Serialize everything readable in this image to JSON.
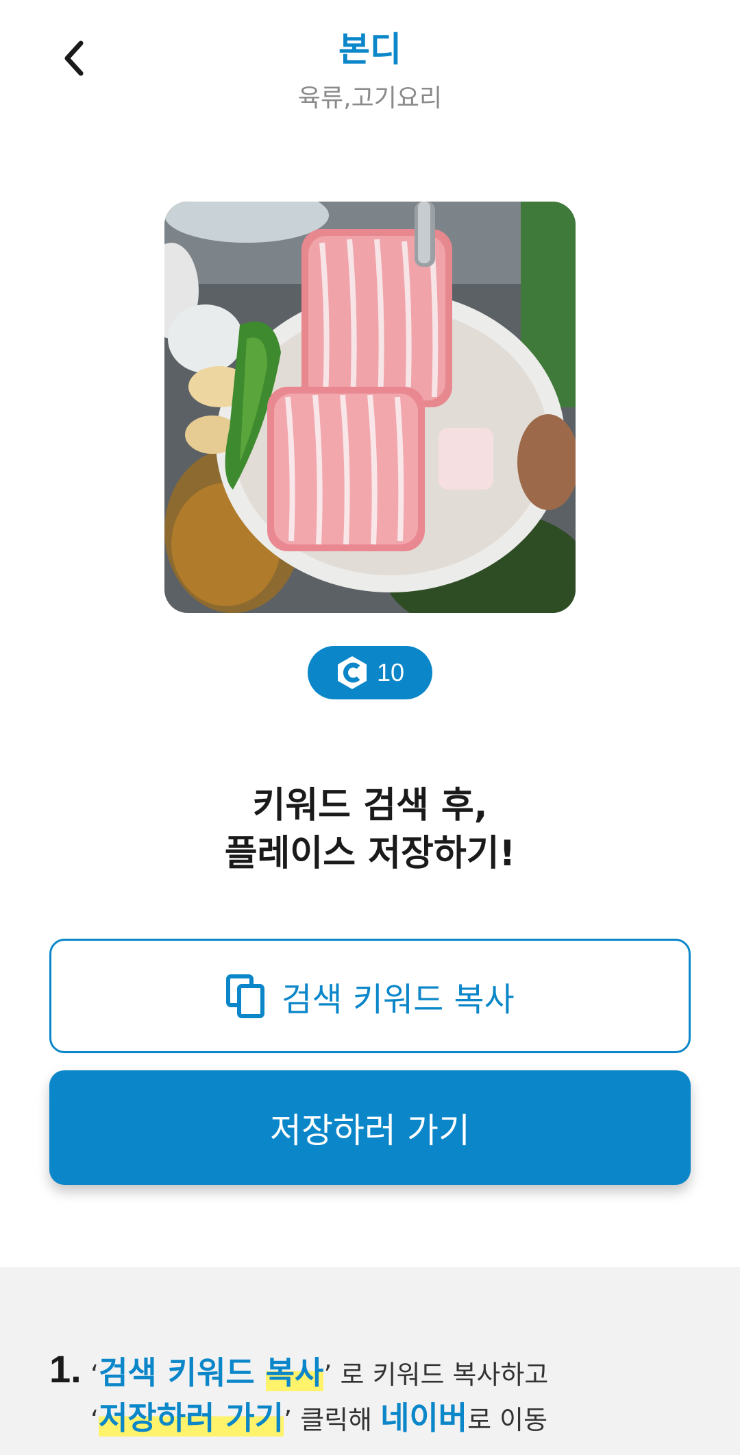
{
  "header": {
    "title": "본디",
    "subtitle": "육류,고기요리"
  },
  "reward": {
    "coin_icon": "coin-c-icon",
    "amount": "10"
  },
  "headline": {
    "line1": "키워드 검색 후,",
    "line2": "플레이스 저장하기!"
  },
  "buttons": {
    "copy_label": "검색 키워드 복사",
    "go_label": "저장하러 가기"
  },
  "guide": {
    "step_number": "1.",
    "quote_open": "‘",
    "quote_close": "’",
    "line1_keyword_a": "검색 키워드 ",
    "line1_keyword_b": "복사",
    "line1_rest": " 로 키워드 복사하고",
    "line2_keyword": "저장하러 가기",
    "line2_mid": " 클릭해 ",
    "line2_brand": "네이버",
    "line2_rest": "로 이동"
  },
  "colors": {
    "accent": "#0a86c9",
    "highlight": "#fff36b",
    "guide_bg": "#f2f2f2"
  }
}
